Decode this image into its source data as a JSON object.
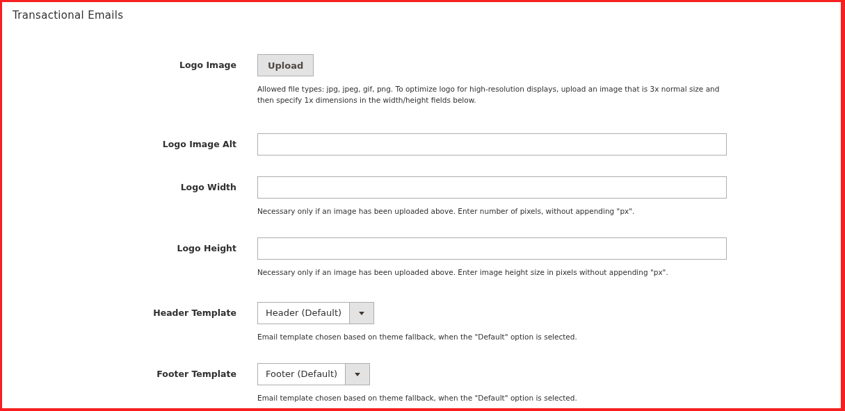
{
  "section": {
    "title": "Transactional Emails"
  },
  "fields": [
    {
      "kind": "upload",
      "label": "Logo Image",
      "button": "Upload",
      "note": "Allowed file types: jpg, jpeg, gif, png. To optimize logo for high-resolution displays, upload an image that is 3x normal size and then specify 1x dimensions in the width/height fields below."
    },
    {
      "kind": "text",
      "label": "Logo Image Alt"
    },
    {
      "kind": "text",
      "label": "Logo Width",
      "note": "Necessary only if an image has been uploaded above. Enter number of pixels, without appending \"px\"."
    },
    {
      "kind": "text",
      "label": "Logo Height",
      "note": "Necessary only if an image has been uploaded above. Enter image height size in pixels without appending \"px\"."
    },
    {
      "kind": "select",
      "label": "Header Template",
      "value": "Header (Default)",
      "note": "Email template chosen based on theme fallback, when the \"Default\" option is selected."
    },
    {
      "kind": "select",
      "label": "Footer Template",
      "value": "Footer (Default)",
      "note": "Email template chosen based on theme fallback, when the \"Default\" option is selected."
    }
  ]
}
